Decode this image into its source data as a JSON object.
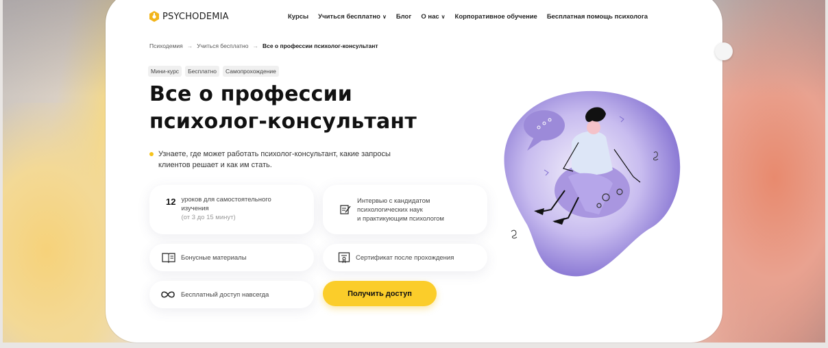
{
  "brand": {
    "name": "PSYCHODEMIA"
  },
  "nav": {
    "items": [
      {
        "label": "Курсы",
        "has_dropdown": false
      },
      {
        "label": "Учиться бесплатно",
        "has_dropdown": true
      },
      {
        "label": "Блог",
        "has_dropdown": false
      },
      {
        "label": "О нас",
        "has_dropdown": true
      },
      {
        "label": "Корпоративное обучение",
        "has_dropdown": false
      },
      {
        "label": "Бесплатная помощь психолога",
        "has_dropdown": false
      }
    ]
  },
  "breadcrumb": {
    "items": [
      "Психодемия",
      "Учиться бесплатно",
      "Все о профессии психолог-консультант"
    ],
    "separator": "→"
  },
  "tags": [
    "Мини-курс",
    "Бесплатно",
    "Самопрохождение"
  ],
  "hero": {
    "title_line1": "Все о профессии",
    "title_line2": "психолог-консультант",
    "lead": "Узнаете, где может работать психолог-консультант, какие запросы клиентов решает и как им стать."
  },
  "features": {
    "lessons": {
      "count": "12",
      "line1": "уроков для самостоятельного",
      "line2": "изучения",
      "note": "(от 3 до 15 минут)"
    },
    "interview": {
      "line1": "Интервью с кандидатом",
      "line2": "психологических наук",
      "line3": "и практикующим психологом"
    },
    "bonus": {
      "label": "Бонусные материалы"
    },
    "certificate": {
      "label": "Сертификат после прохождения"
    },
    "access": {
      "label": "Бесплатный доступ навсегда"
    }
  },
  "cta": {
    "label": "Получить доступ"
  },
  "colors": {
    "accent": "#fbcd2a",
    "dot": "#f6c31b",
    "illustration": "#8f7cd6",
    "brand_icon": "#f2b51c"
  }
}
